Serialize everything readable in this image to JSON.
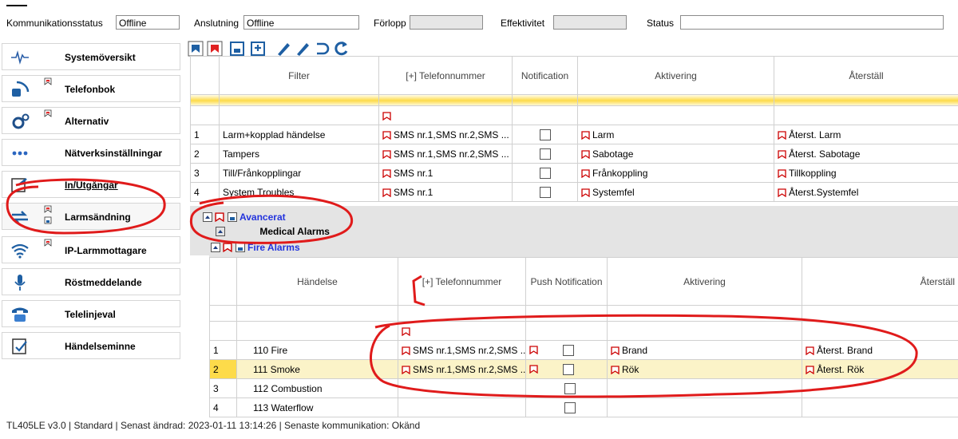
{
  "topbar": {
    "comm_status_label": "Kommunikationsstatus",
    "comm_status_value": "Offline",
    "connection_label": "Anslutning",
    "connection_value": "Offline",
    "progress_label": "Förlopp",
    "efficiency_label": "Effektivitet",
    "status_label": "Status"
  },
  "sidebar": {
    "items": [
      {
        "label": "Systemöversikt"
      },
      {
        "label": "Telefonbok"
      },
      {
        "label": "Alternativ"
      },
      {
        "label": "Nätverksinställningar"
      },
      {
        "label": "In/Utgångar"
      },
      {
        "label": "Larmsändning"
      },
      {
        "label": "IP-Larmmottagare"
      },
      {
        "label": "Röstmeddelande"
      },
      {
        "label": "Telelinjeval"
      },
      {
        "label": "Händelseminne"
      }
    ]
  },
  "grid1": {
    "headers": [
      "Filter",
      "[+] Telefonnummer",
      "Notification",
      "Aktivering",
      "Återställ"
    ],
    "rows": [
      {
        "num": "1",
        "filter": "Larm+kopplad händelse",
        "phone": "SMS nr.1,SMS nr.2,SMS ...",
        "act": "Larm",
        "reset": "Återst. Larm"
      },
      {
        "num": "2",
        "filter": "Tampers",
        "phone": "SMS nr.1,SMS nr.2,SMS ...",
        "act": "Sabotage",
        "reset": "Återst. Sabotage"
      },
      {
        "num": "3",
        "filter": "Till/Frånkopplingar",
        "phone": "SMS nr.1",
        "act": "Frånkoppling",
        "reset": "Tillkoppling"
      },
      {
        "num": "4",
        "filter": "System Troubles",
        "phone": "SMS nr.1",
        "act": "Systemfel",
        "reset": "Återst.Systemfel"
      }
    ]
  },
  "sections": {
    "advanced": "Avancerat",
    "medical": "Medical Alarms",
    "fire": "Fire Alarms"
  },
  "grid2": {
    "headers": [
      "Händelse",
      "[+] Telefonnummer",
      "Push Notification",
      "Aktivering",
      "Återställ"
    ],
    "rows": [
      {
        "num": "1",
        "event": "110 Fire",
        "phone": "SMS nr.1,SMS nr.2,SMS ...",
        "act": "Brand",
        "reset": "Återst. Brand"
      },
      {
        "num": "2",
        "event": "111 Smoke",
        "phone": "SMS nr.1,SMS nr.2,SMS ...",
        "act": "Rök",
        "reset": "Återst. Rök"
      },
      {
        "num": "3",
        "event": "112 Combustion",
        "phone": "",
        "act": "",
        "reset": ""
      },
      {
        "num": "4",
        "event": "113 Waterflow",
        "phone": "",
        "act": "",
        "reset": ""
      }
    ]
  },
  "statusbar": {
    "text": "TL405LE v3.0 | Standard | Senast ändrad: 2023-01-11 13:14:26 | Senaste kommunikation: Okänd"
  },
  "colors": {
    "annotation_red": "#e01b1b",
    "row_highlight": "#fddb4a",
    "link_blue": "#2233dd"
  }
}
